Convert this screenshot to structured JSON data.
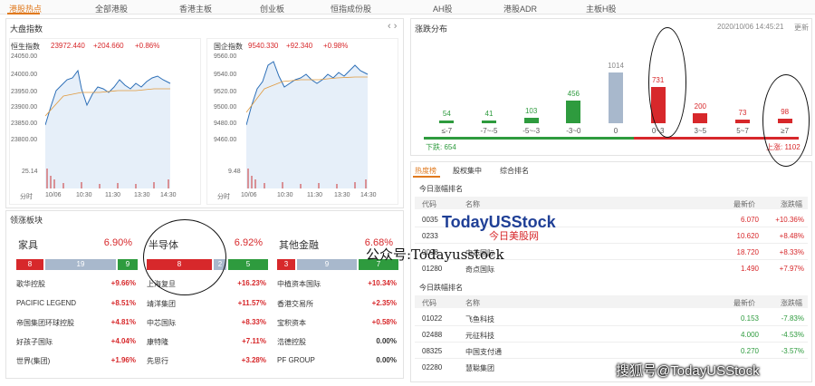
{
  "nav": {
    "tabs": [
      "港股热点",
      "全部港股",
      "香港主板",
      "创业板",
      "恒指成份股",
      "AH股",
      "港股ADR",
      "主板H股"
    ]
  },
  "market_index": {
    "title": "大盘指数",
    "hsi": {
      "name": "恒生指数",
      "value": "23972.440",
      "change": "+204.660",
      "pct": "+0.86%",
      "yticks": [
        "24050.00",
        "24000.00",
        "23950.00",
        "23900.00",
        "23850.00",
        "23800.00"
      ],
      "vol_tick": "25.14",
      "xticks": [
        "10/06",
        "10:30",
        "11:30",
        "13:30",
        "14:30"
      ],
      "unit_label": "分时"
    },
    "hscei": {
      "name": "国企指数",
      "value": "9540.330",
      "change": "+92.340",
      "pct": "+0.98%",
      "yticks": [
        "9560.00",
        "9540.00",
        "9520.00",
        "9500.00",
        "9480.00",
        "9460.00"
      ],
      "vol_tick": "9.48",
      "xticks": [
        "10/06",
        "10:30",
        "11:30",
        "13:30",
        "14:30"
      ],
      "unit_label": "分时"
    }
  },
  "distribution": {
    "title": "涨跌分布",
    "timestamp": "2020/10/06 14:45:21",
    "refresh": "更新",
    "down_label": "下跌: 654",
    "up_label": "上涨: 1102",
    "down_count": 654,
    "up_count": 1102,
    "flat_count": 1014,
    "chart_data": {
      "type": "bar",
      "categories": [
        "≤-7",
        "-7~-5",
        "-5~-3",
        "-3~0",
        "0",
        "0~3",
        "3~5",
        "5~7",
        "≥7"
      ],
      "values": [
        54,
        41,
        103,
        456,
        1014,
        731,
        200,
        73,
        98
      ],
      "colors": [
        "#2e9b3e",
        "#2e9b3e",
        "#2e9b3e",
        "#2e9b3e",
        "#a8b8cc",
        "#d7282b",
        "#d7282b",
        "#d7282b",
        "#d7282b"
      ]
    }
  },
  "sectors": {
    "title": "领涨板块",
    "items": [
      {
        "name": "家具",
        "pct": "6.90%",
        "up": "8",
        "flat": "19",
        "down": "9",
        "stocks": [
          {
            "name": "歌华控股",
            "pct": "+9.66%"
          },
          {
            "name": "PACIFIC LEGEND",
            "pct": "+8.51%"
          },
          {
            "name": "帝国集团环球控股",
            "pct": "+4.81%"
          },
          {
            "name": "好孩子国际",
            "pct": "+4.04%"
          },
          {
            "name": "世界(集团)",
            "pct": "+1.96%"
          }
        ]
      },
      {
        "name": "半导体",
        "pct": "6.92%",
        "up": "8",
        "flat": "2",
        "down": "5",
        "stocks": [
          {
            "name": "上海复旦",
            "pct": "+16.23%"
          },
          {
            "name": "靖洋集团",
            "pct": "+11.57%"
          },
          {
            "name": "中芯国际",
            "pct": "+8.33%"
          },
          {
            "name": "康特隆",
            "pct": "+7.11%"
          },
          {
            "name": "先思行",
            "pct": "+3.28%"
          }
        ]
      },
      {
        "name": "其他金融",
        "pct": "6.68%",
        "up": "3",
        "flat": "9",
        "down": "7",
        "stocks": [
          {
            "name": "中植资本国际",
            "pct": "+10.34%"
          },
          {
            "name": "香港交易所",
            "pct": "+2.35%"
          },
          {
            "name": "宝积资本",
            "pct": "+0.58%"
          },
          {
            "name": "浩德控股",
            "pct": "0.00%"
          },
          {
            "name": "PF GROUP",
            "pct": "0.00%"
          }
        ]
      }
    ]
  },
  "rankings": {
    "tabs": [
      "热度榜",
      "股权集中",
      "综合排名"
    ],
    "gainers": {
      "title": "今日涨幅排名",
      "headers": [
        "代码",
        "名称",
        "最新价",
        "涨跌幅"
      ],
      "rows": [
        {
          "code": "0035",
          "name": "",
          "price": "6.070",
          "pct": "+10.36%"
        },
        {
          "code": "0233",
          "name": "",
          "price": "10.620",
          "pct": "+8.48%"
        },
        {
          "code": "0098",
          "name": "中芯国际",
          "price": "18.720",
          "pct": "+8.33%"
        },
        {
          "code": "01280",
          "name": "奇点国际",
          "price": "1.490",
          "pct": "+7.97%"
        }
      ]
    },
    "losers": {
      "title": "今日跌幅排名",
      "headers": [
        "代码",
        "名称",
        "最新价",
        "涨跌幅"
      ],
      "rows": [
        {
          "code": "01022",
          "name": "飞鱼科技",
          "price": "0.153",
          "pct": "-7.83%"
        },
        {
          "code": "02488",
          "name": "元征科技",
          "price": "4.000",
          "pct": "-4.53%"
        },
        {
          "code": "08325",
          "name": "中国支付通",
          "price": "0.270",
          "pct": "-3.57%"
        },
        {
          "code": "02280",
          "name": "慧聪集团",
          "price": "",
          "pct": ""
        }
      ]
    }
  },
  "watermarks": {
    "brand": "TodayUSStock",
    "brand_cn": "今日美股网",
    "wechat": "公众号:Todayusstock",
    "sohu": "搜狐号@TodayUSStock"
  }
}
